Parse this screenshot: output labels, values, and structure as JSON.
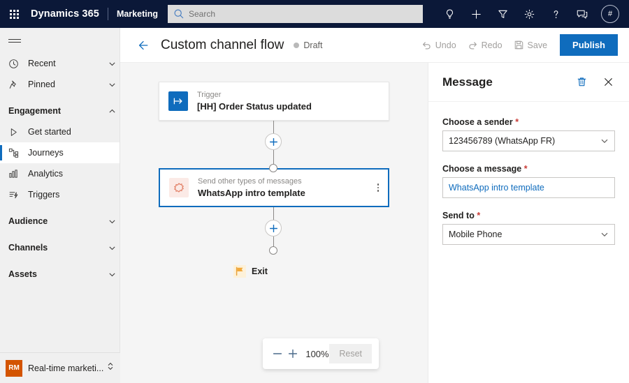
{
  "topnav": {
    "waffle_label": "app-launcher",
    "brand": "Dynamics 365",
    "app_name": "Marketing",
    "search_placeholder": "Search",
    "actions": [
      {
        "name": "lightbulb-icon",
        "label": "Insights"
      },
      {
        "name": "plus-icon",
        "label": "New"
      },
      {
        "name": "filter-icon",
        "label": "Filter"
      },
      {
        "name": "gear-icon",
        "label": "Settings"
      },
      {
        "name": "question-icon",
        "label": "Help"
      },
      {
        "name": "feedback-icon",
        "label": "Feedback"
      }
    ],
    "avatar_initials": "#"
  },
  "sidebar": {
    "hamburger_label": "Show/hide navigation",
    "items": [
      {
        "label": "Recent",
        "icon": "clock-icon",
        "type": "expandable",
        "selected": false
      },
      {
        "label": "Pinned",
        "icon": "pin-icon",
        "type": "expandable",
        "selected": false
      },
      {
        "label": "Engagement",
        "icon": "",
        "type": "group-open",
        "selected": false
      },
      {
        "label": "Get started",
        "icon": "play-icon",
        "type": "link",
        "selected": false
      },
      {
        "label": "Journeys",
        "icon": "journeys-icon",
        "type": "link",
        "selected": true
      },
      {
        "label": "Analytics",
        "icon": "analytics-icon",
        "type": "link",
        "selected": false
      },
      {
        "label": "Triggers",
        "icon": "triggers-icon",
        "type": "link",
        "selected": false
      },
      {
        "label": "Audience",
        "icon": "",
        "type": "group",
        "selected": false
      },
      {
        "label": "Channels",
        "icon": "",
        "type": "group",
        "selected": false
      },
      {
        "label": "Assets",
        "icon": "",
        "type": "group",
        "selected": false
      }
    ],
    "footer": {
      "badge": "RM",
      "badge_color": "#d35400",
      "label": "Real-time marketi...",
      "switcher_icon": "chevron-updown-icon"
    }
  },
  "commandbar": {
    "back_label": "Back",
    "title": "Custom channel flow",
    "status": "Draft",
    "status_dot_color": "#b9b9b9",
    "undo_label": "Undo",
    "redo_label": "Redo",
    "save_label": "Save",
    "publish_label": "Publish",
    "publish_color": "#0f6cbd"
  },
  "canvas": {
    "nodes": [
      {
        "id": "trigger",
        "kicker": "Trigger",
        "title": "[HH] Order Status updated",
        "icon": "trigger-arrow-icon",
        "icon_bg": "#0f6cbd",
        "selected": false
      },
      {
        "id": "message",
        "kicker": "Send other types of messages",
        "title": "WhatsApp intro template",
        "icon": "custom-channel-icon",
        "icon_bg": "#fbeae6",
        "selected": true
      }
    ],
    "add_button_label": "Add step",
    "exit": {
      "label": "Exit",
      "icon": "flag-icon",
      "icon_color": "#f2a93b"
    },
    "zoom": {
      "out_label": "Zoom out",
      "in_label": "Zoom in",
      "level": "100%",
      "reset_label": "Reset"
    }
  },
  "panel": {
    "title": "Message",
    "delete_icon": "trash-icon",
    "close_icon": "close-icon",
    "fields": [
      {
        "label": "Choose a sender",
        "required": true,
        "value": "123456789 (WhatsApp FR)",
        "control": "dropdown",
        "name": "choose-a-sender"
      },
      {
        "label": "Choose a message",
        "required": true,
        "value": "WhatsApp intro template",
        "control": "link",
        "name": "choose-a-message"
      },
      {
        "label": "Send to",
        "required": true,
        "value": "Mobile Phone",
        "control": "dropdown",
        "name": "send-to"
      }
    ]
  }
}
